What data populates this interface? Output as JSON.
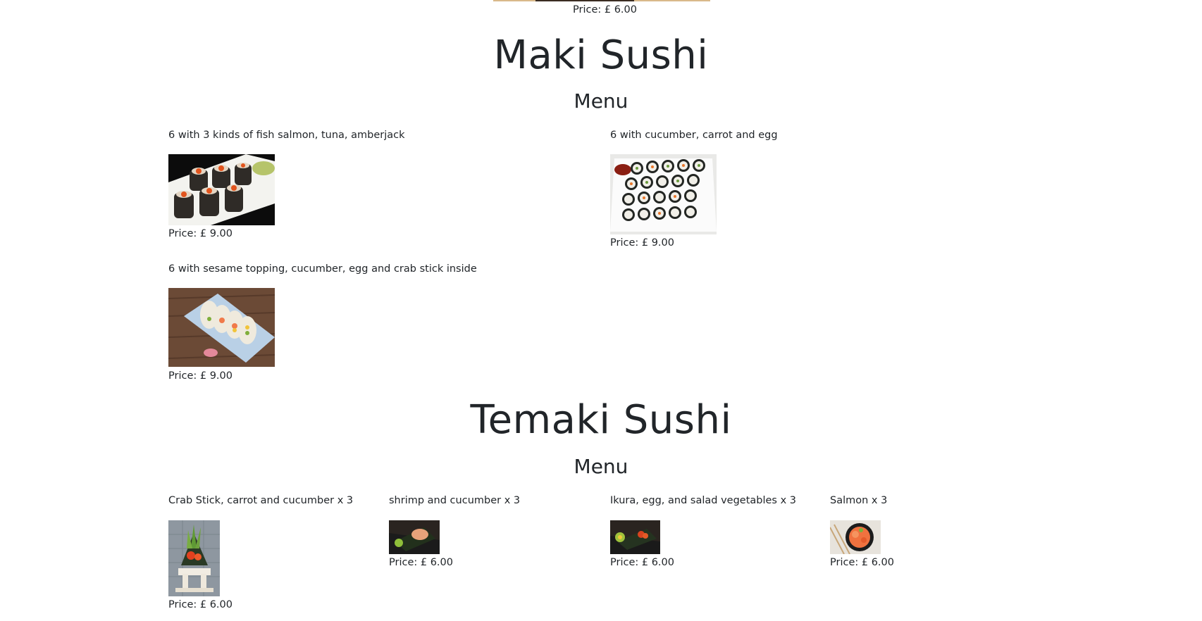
{
  "top_item": {
    "price": "Price: £ 6.00"
  },
  "maki": {
    "title": "Maki Sushi",
    "menu_label": "Menu",
    "items": [
      {
        "description": "6 with 3 kinds of fish salmon, tuna, amberjack",
        "price": "Price: £ 9.00",
        "image": "maki-salmon-tuna-amberjack-photo"
      },
      {
        "description": "6 with cucumber, carrot and egg",
        "price": "Price: £ 9.00",
        "image": "maki-cucumber-carrot-egg-photo"
      },
      {
        "description": "6 with sesame topping, cucumber, egg and crab stick inside",
        "price": "Price: £ 9.00",
        "image": "maki-sesame-crab-photo"
      }
    ]
  },
  "temaki": {
    "title": "Temaki Sushi",
    "menu_label": "Menu",
    "items": [
      {
        "description": "Crab Stick, carrot and cucumber x 3",
        "price": "Price: £ 6.00",
        "image": "temaki-crab-stick-photo"
      },
      {
        "description": "shrimp and cucumber x 3",
        "price": "Price: £ 6.00",
        "image": "temaki-shrimp-photo"
      },
      {
        "description": "Ikura, egg, and salad vegetables x 3",
        "price": "Price: £ 6.00",
        "image": "temaki-ikura-photo"
      },
      {
        "description": "Salmon x 3",
        "price": "Price: £ 6.00",
        "image": "temaki-salmon-photo"
      }
    ]
  }
}
